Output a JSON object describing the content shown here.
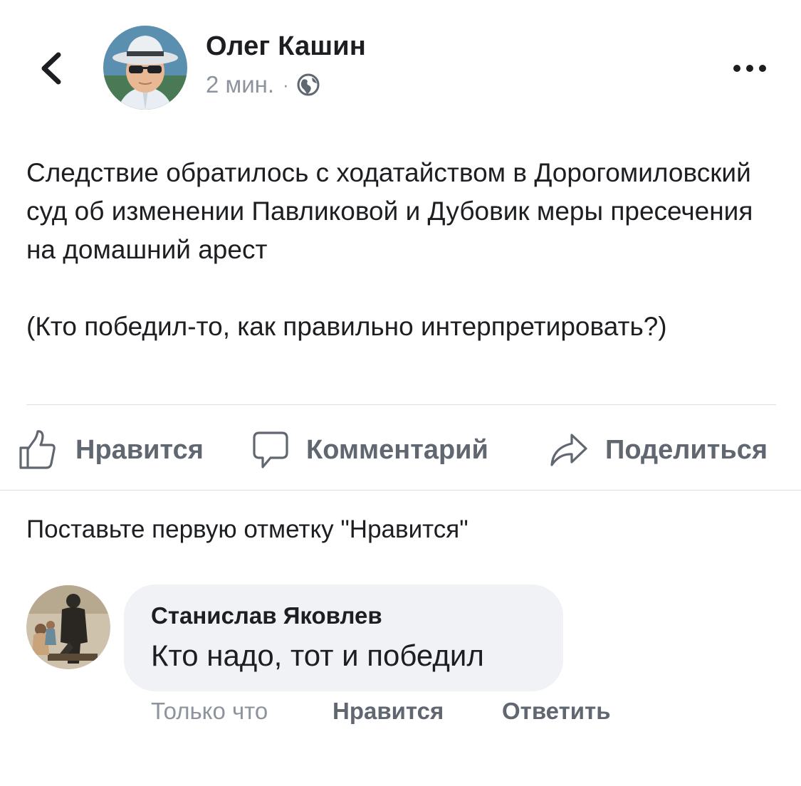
{
  "header": {
    "back_icon": "chevron-left-icon",
    "author_name": "Олег Кашин",
    "timestamp": "2 мин.",
    "separator": "·",
    "privacy_icon": "globe-icon",
    "more_icon": "more-horizontal-icon"
  },
  "post": {
    "paragraph_1": "Следствие обратилось с ходатайством в Дорогомиловский суд об изменении Павликовой и Дубовик меры пресечения на домашний арест",
    "paragraph_2": "(Кто победил-то, как правильно интерпретировать?)"
  },
  "actions": {
    "like": {
      "label": "Нравится",
      "icon": "thumbs-up-icon"
    },
    "comment": {
      "label": "Комментарий",
      "icon": "comment-bubble-icon"
    },
    "share": {
      "label": "Поделиться",
      "icon": "share-arrow-icon"
    }
  },
  "reactions": {
    "first_like_prompt": "Поставьте первую отметку \"Нравится\""
  },
  "comments": [
    {
      "author": "Станислав Яковлев",
      "text": "Кто надо, тот и победил",
      "time": "Только что",
      "like_label": "Нравится",
      "reply_label": "Ответить"
    }
  ],
  "colors": {
    "text_primary": "#1c1e21",
    "text_secondary": "#8d949e",
    "action_gray": "#606770",
    "bubble_bg": "#f0f2f5",
    "divider": "#dadde1"
  }
}
